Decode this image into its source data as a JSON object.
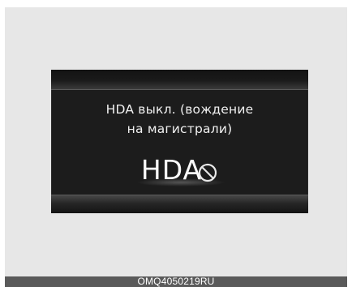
{
  "display": {
    "message_line1": "HDA выкл. (вождение",
    "message_line2": "на магистрали)",
    "hda_label": "HDA",
    "status_icon": "prohibited-icon"
  },
  "caption": {
    "code": "OMQ4050219RU"
  },
  "colors": {
    "background": "#e7e7e7",
    "screen": "#1c1c1c",
    "text": "#f0f0f0",
    "caption_bar": "#5a5a5a"
  }
}
